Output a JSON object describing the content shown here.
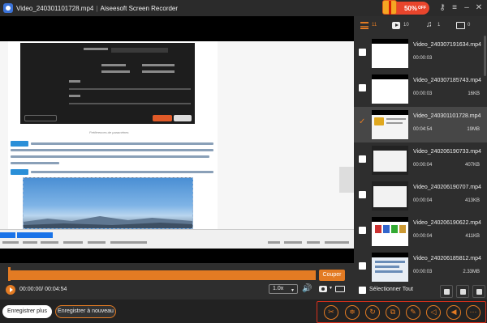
{
  "window": {
    "file_title": "Video_240301101728.mp4",
    "separator": "|",
    "app_name": "Aiseesoft Screen Recorder",
    "promo_value": "50%",
    "promo_suffix": "OFF"
  },
  "filter_tabs": [
    {
      "name": "all",
      "count": "11"
    },
    {
      "name": "video",
      "count": "10"
    },
    {
      "name": "audio",
      "count": "1"
    },
    {
      "name": "image",
      "count": "0"
    }
  ],
  "recordings": [
    {
      "name": "Video_240307191634.mp4",
      "duration": "00:00:03",
      "size": "",
      "selected": false
    },
    {
      "name": "Video_240307185743.mp4",
      "duration": "00:00:03",
      "size": "16KB",
      "selected": false
    },
    {
      "name": "Video_240301101728.mp4",
      "duration": "00:04:54",
      "size": "19MB",
      "selected": true
    },
    {
      "name": "Video_240206190733.mp4",
      "duration": "00:00:04",
      "size": "407KB",
      "selected": false
    },
    {
      "name": "Video_240206190707.mp4",
      "duration": "00:00:04",
      "size": "413KB",
      "selected": false
    },
    {
      "name": "Video_240206190622.mp4",
      "duration": "00:00:04",
      "size": "411KB",
      "selected": false
    },
    {
      "name": "Video_240206185812.mp4",
      "duration": "00:00:03",
      "size": "2.33MB",
      "selected": false
    }
  ],
  "sidebar_footer": {
    "select_all_label": "Sélectionner Tout"
  },
  "timeline": {
    "cut_label": "Couper",
    "time_display": "00:00:00/ 00:04:54",
    "speed": "1.0x",
    "playhead_progress": 0.0
  },
  "bottombar": {
    "record_more_label": "Enregistrer plus",
    "record_again_label": "Enregistrer à nouveau"
  },
  "preview": {
    "caption": "Préférences de paramètres"
  },
  "colors": {
    "accent": "#e37b23",
    "promo": "#e8452c",
    "highlight_frame": "#d9301c"
  },
  "icons": {
    "window_controls": [
      "gift-icon",
      "key-icon",
      "menu-icon",
      "minimize-icon",
      "close-icon"
    ],
    "tools": [
      "scissors-icon",
      "clip-trim-icon",
      "rotate-icon",
      "merge-icon",
      "edit-icon",
      "volume-adjust-icon",
      "audio-add-icon",
      "more-icon"
    ],
    "footer": [
      "trash-icon",
      "folder-export-icon",
      "folder-open-icon"
    ]
  }
}
